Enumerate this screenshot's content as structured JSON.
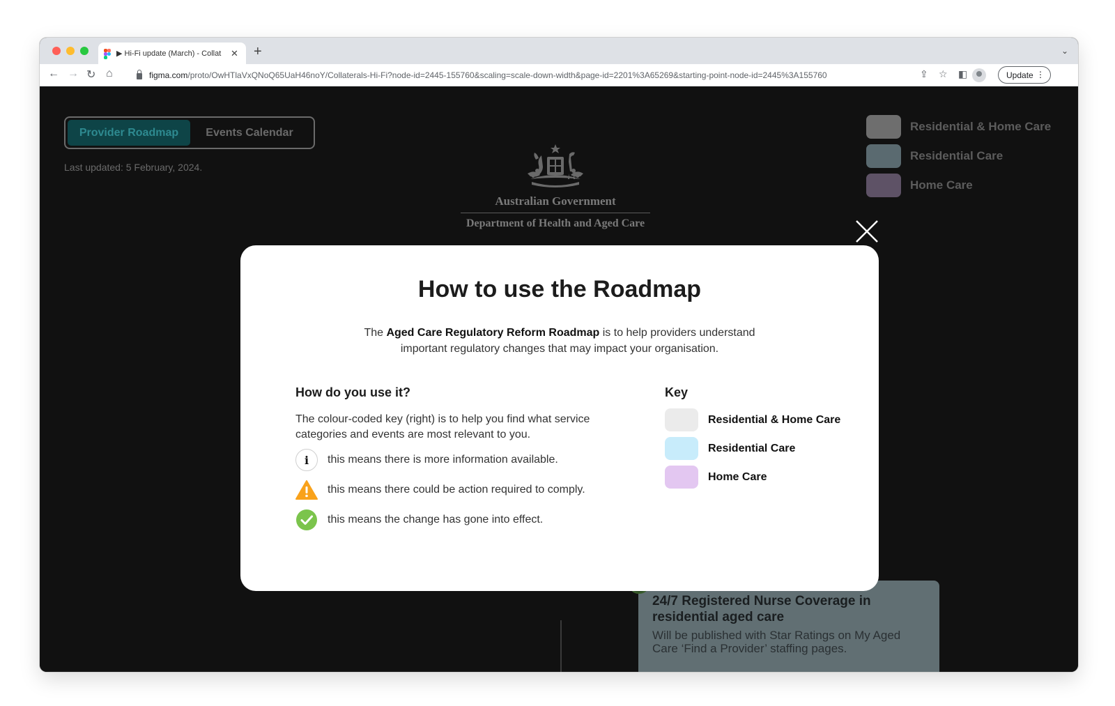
{
  "browser": {
    "tab_title": "▶ Hi-Fi update (March) - Collat",
    "tab_close": "✕",
    "new_tab": "+",
    "tab_dropdown": "⌄",
    "url_domain": "figma.com",
    "url_path": "/proto/OwHTlaVxQNoQ65UaH46noY/Collaterals-Hi-Fi?node-id=2445-155760&scaling=scale-down-width&page-id=2201%3A65269&starting-point-node-id=2445%3A155760",
    "update_label": "Update",
    "icons": [
      "back-icon",
      "forward-icon",
      "reload-icon",
      "home-icon",
      "lock-icon",
      "share-icon",
      "star-icon",
      "sidepanel-icon",
      "profile-icon",
      "kebab-icon"
    ]
  },
  "page": {
    "tabs": [
      {
        "label": "Provider Roadmap",
        "active": true
      },
      {
        "label": "Events Calendar",
        "active": false
      }
    ],
    "last_updated": "Last updated: 5 February, 2024.",
    "logo": {
      "line1": "Australian Government",
      "line2": "Department of Health and Aged Care"
    },
    "legend": [
      {
        "label": "Residential & Home Care",
        "color": "#6e6e6e"
      },
      {
        "label": "Residential Care",
        "color": "#5a6a70"
      },
      {
        "label": "Home Care",
        "color": "#5e5266"
      }
    ],
    "event_card": {
      "title": "24/7 Registered Nurse Coverage in residential aged care",
      "description": "Will be published with Star Ratings on My Aged Care ‘Find a Provider’ staffing pages."
    }
  },
  "modal": {
    "title": "How to use the Roadmap",
    "intro_prefix": "The ",
    "intro_bold": "Aged Care Regulatory Reform Roadmap",
    "intro_suffix": " is to help providers understand important regulatory changes that may impact your organisation.",
    "how_heading": "How do you use it?",
    "how_body": "The colour-coded key (right) is to help you find what service categories and events are most relevant to you.",
    "icon_rows": [
      {
        "icon": "info-icon",
        "text": "this means there is more information available."
      },
      {
        "icon": "warning-icon",
        "text": "this means there could be action required to comply."
      },
      {
        "icon": "check-icon",
        "text": "this means the change has gone into effect."
      }
    ],
    "key_heading": "Key",
    "key": [
      {
        "label": "Residential & Home Care",
        "color": "#ebebeb"
      },
      {
        "label": "Residential Care",
        "color": "#c8ecfb"
      },
      {
        "label": "Home Care",
        "color": "#e3c7f1"
      }
    ]
  }
}
